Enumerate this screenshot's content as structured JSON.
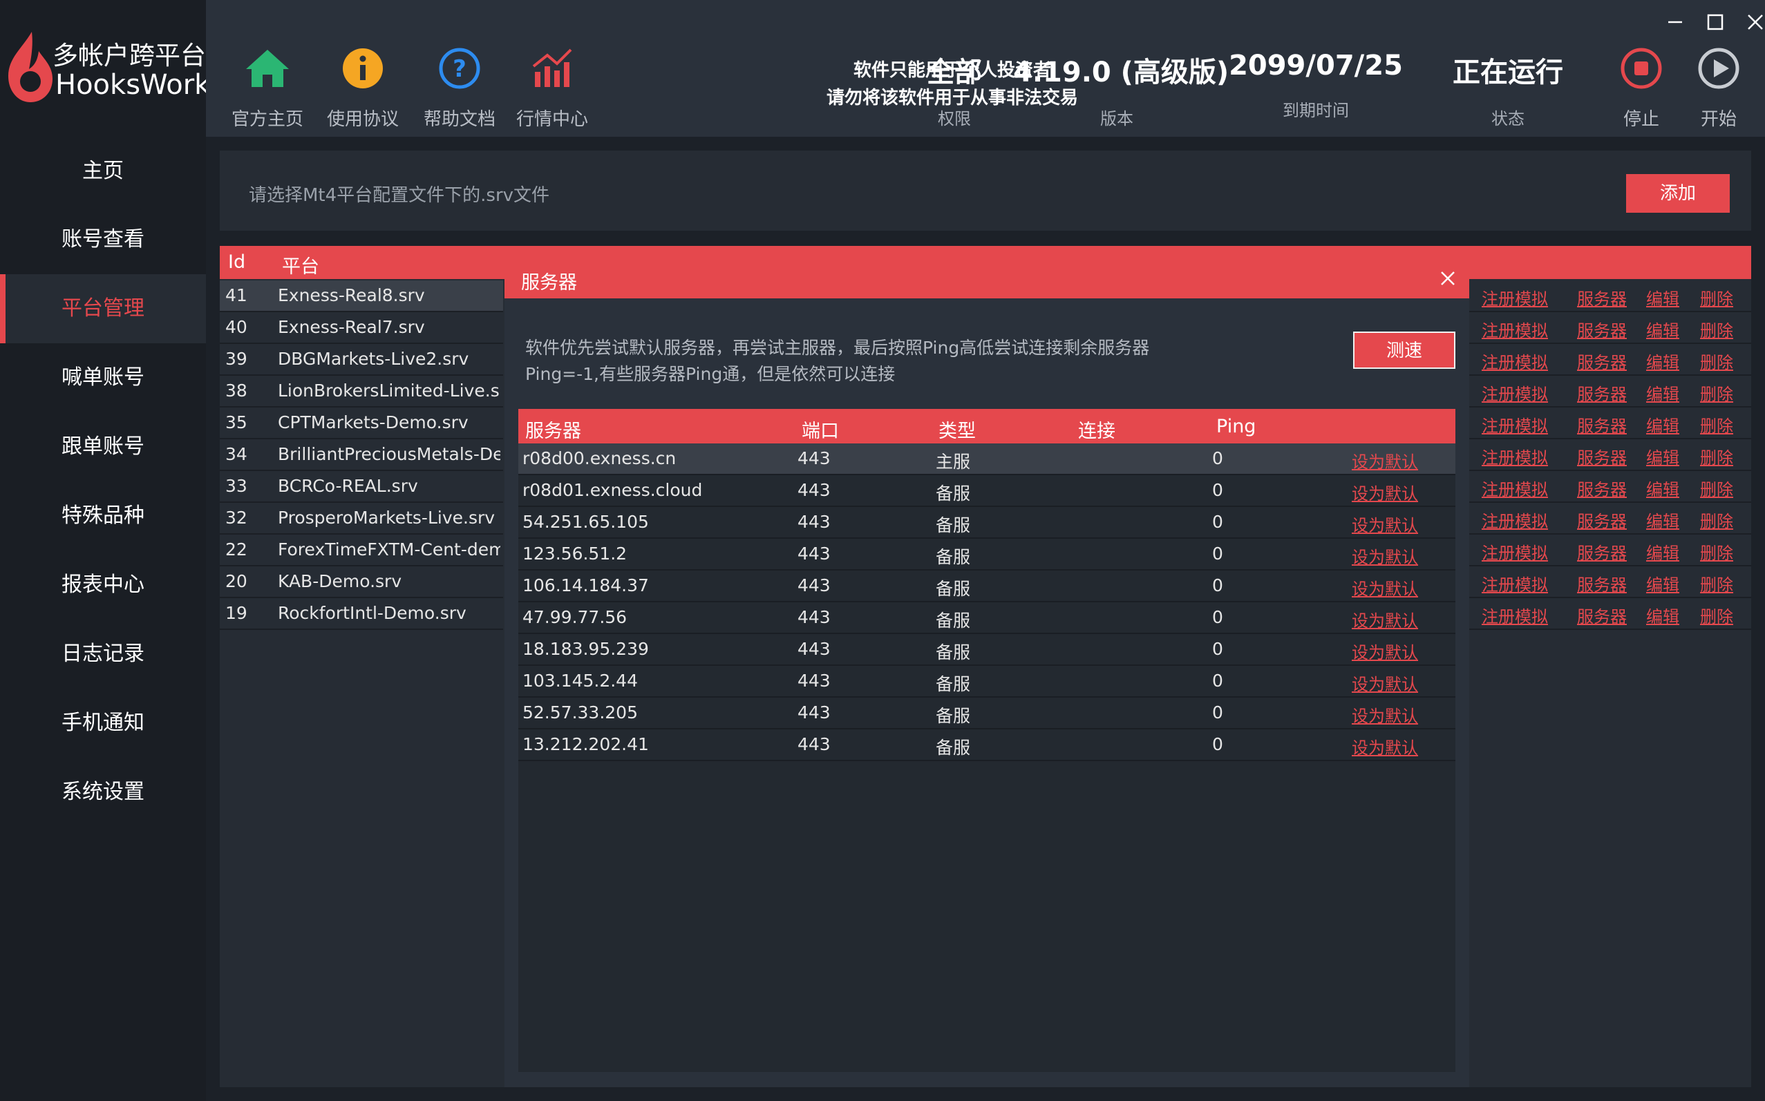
{
  "app": {
    "title_line1": "多帐户跨平台",
    "title_line2": "HooksWork"
  },
  "nav": [
    "主页",
    "账号查看",
    "平台管理",
    "喊单账号",
    "跟单账号",
    "特殊品种",
    "报表中心",
    "日志记录",
    "手机通知",
    "系统设置"
  ],
  "nav_active": "平台管理",
  "toolbar": {
    "home": "官方主页",
    "agreement": "使用协议",
    "help": "帮助文档",
    "market": "行情中心",
    "stop": "停止",
    "start": "开始"
  },
  "notice": {
    "line1": "软件只能用于个人投资者",
    "line2": "请勿将该软件用于从事非法交易"
  },
  "status": {
    "permission": {
      "value": "全部",
      "label": "权限"
    },
    "version": {
      "value": "4.19.0 (高级版)",
      "label": "版本"
    },
    "expiry": {
      "value": "2099/07/25",
      "label": "到期时间"
    },
    "state": {
      "value": "正在运行",
      "label": "状态"
    }
  },
  "file_bar": {
    "placeholder": "请选择Mt4平台配置文件下的.srv文件",
    "add_label": "添加"
  },
  "platform_table": {
    "headers": {
      "id": "Id",
      "platform": "平台"
    },
    "rows": [
      {
        "id": "41",
        "name": "Exness-Real8.srv"
      },
      {
        "id": "40",
        "name": "Exness-Real7.srv"
      },
      {
        "id": "39",
        "name": "DBGMarkets-Live2.srv"
      },
      {
        "id": "38",
        "name": "LionBrokersLimited-Live.srv"
      },
      {
        "id": "35",
        "name": "CPTMarkets-Demo.srv"
      },
      {
        "id": "34",
        "name": "BrilliantPreciousMetals-Demo.srv"
      },
      {
        "id": "33",
        "name": "BCRCo-REAL.srv"
      },
      {
        "id": "32",
        "name": "ProsperoMarkets-Live.srv"
      },
      {
        "id": "22",
        "name": "ForexTimeFXTM-Cent-demo.srv"
      },
      {
        "id": "20",
        "name": "KAB-Demo.srv"
      },
      {
        "id": "19",
        "name": "RockfortIntl-Demo.srv"
      }
    ],
    "actions": {
      "register": "注册模拟",
      "servers": "服务器",
      "edit": "编辑",
      "delete": "删除"
    }
  },
  "dialog": {
    "title": "服务器",
    "desc1": "软件优先尝试默认服务器，再尝试主服器，最后按照Ping高低尝试连接剩余服务器",
    "desc2": "Ping=-1,有些服务器Ping通，但是依然可以连接",
    "test_label": "测速",
    "columns": {
      "server": "服务器",
      "port": "端口",
      "type": "类型",
      "connect": "连接",
      "ping": "Ping"
    },
    "set_default": "设为默认",
    "rows": [
      {
        "server": "r08d00.exness.cn",
        "port": "443",
        "type": "主服",
        "ping": "0"
      },
      {
        "server": "r08d01.exness.cloud",
        "port": "443",
        "type": "备服",
        "ping": "0"
      },
      {
        "server": "54.251.65.105",
        "port": "443",
        "type": "备服",
        "ping": "0"
      },
      {
        "server": "123.56.51.2",
        "port": "443",
        "type": "备服",
        "ping": "0"
      },
      {
        "server": "106.14.184.37",
        "port": "443",
        "type": "备服",
        "ping": "0"
      },
      {
        "server": "47.99.77.56",
        "port": "443",
        "type": "备服",
        "ping": "0"
      },
      {
        "server": "18.183.95.239",
        "port": "443",
        "type": "备服",
        "ping": "0"
      },
      {
        "server": "103.145.2.44",
        "port": "443",
        "type": "备服",
        "ping": "0"
      },
      {
        "server": "52.57.33.205",
        "port": "443",
        "type": "备服",
        "ping": "0"
      },
      {
        "server": "13.212.202.41",
        "port": "443",
        "type": "备服",
        "ping": "0"
      }
    ]
  },
  "colors": {
    "accent": "#e5484d",
    "sidebar": "#1a1e24",
    "header": "#2a313b",
    "panel": "#262c34",
    "home_icon": "#2bb673",
    "info_icon": "#f5a623",
    "help_icon": "#2d8cf0"
  }
}
